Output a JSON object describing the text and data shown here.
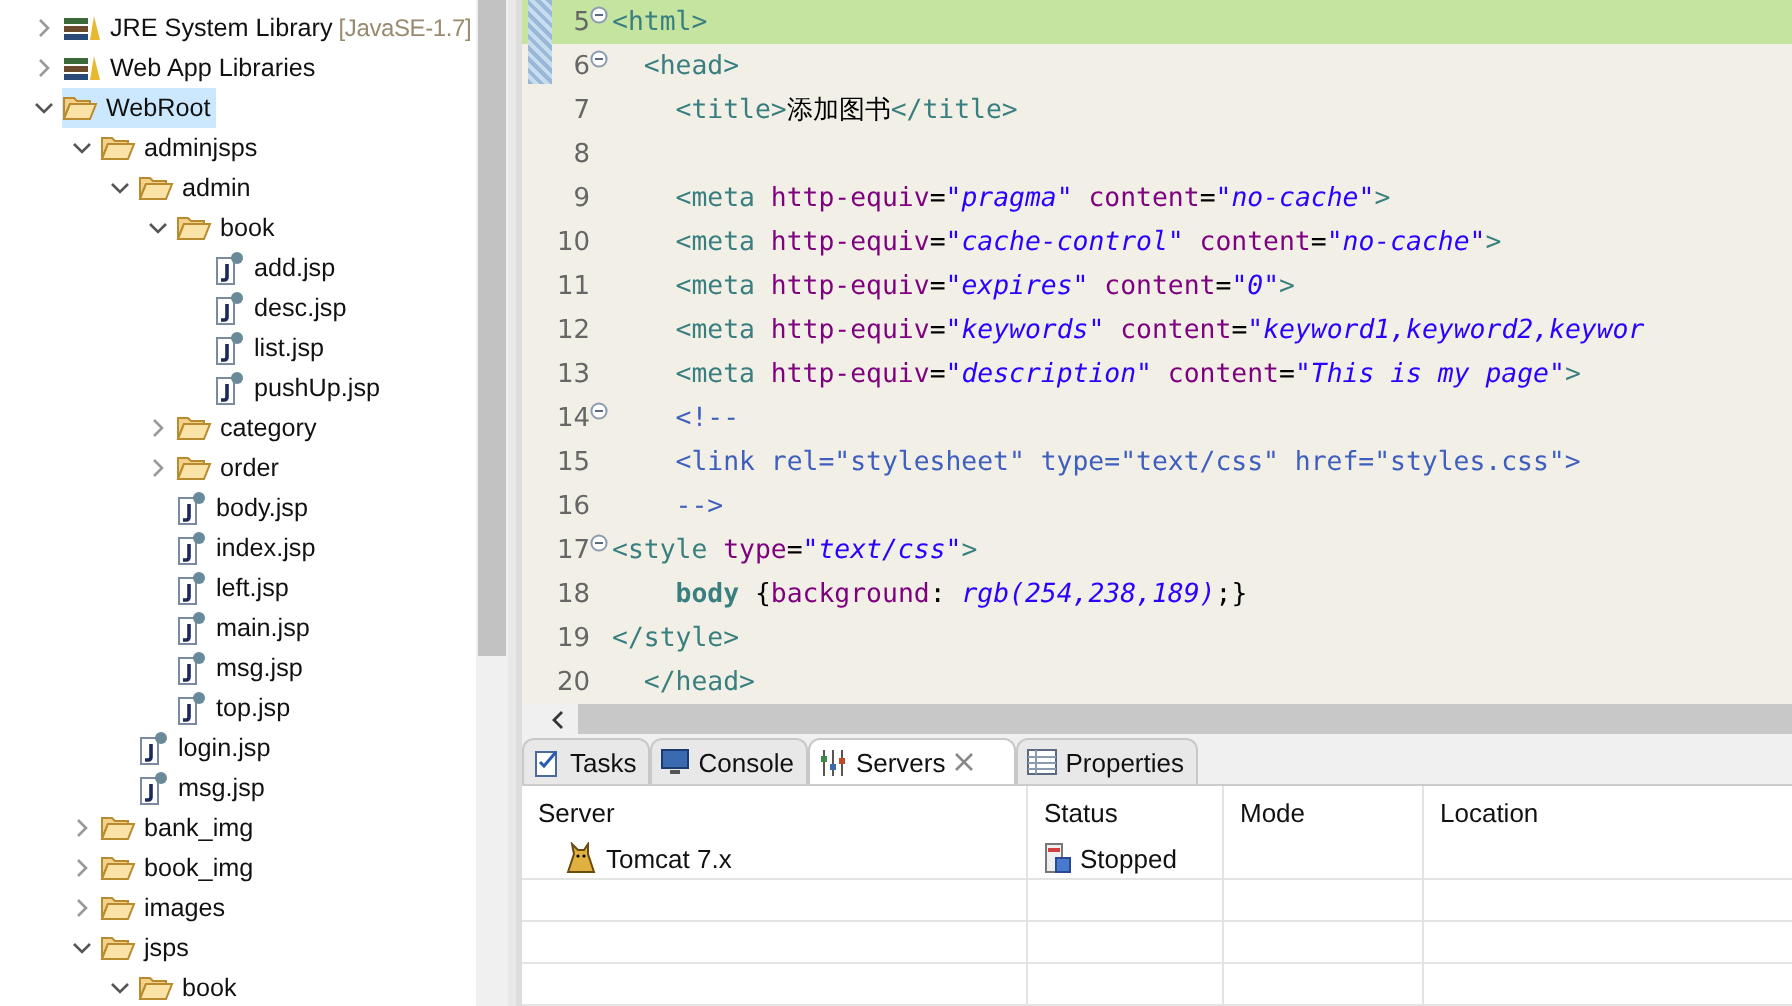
{
  "explorer": {
    "items": [
      {
        "label": "JRE System Library",
        "decoration": "[JavaSE-1.7]",
        "kind": "library",
        "expanded": false,
        "selected": false
      },
      {
        "label": "Web App Libraries",
        "kind": "library",
        "expanded": false,
        "selected": false
      },
      {
        "label": "WebRoot",
        "kind": "folder",
        "expanded": true,
        "selected": true,
        "children": [
          {
            "label": "adminjsps",
            "kind": "folder",
            "expanded": true,
            "selected": false,
            "children": [
              {
                "label": "admin",
                "kind": "folder",
                "expanded": true,
                "selected": false,
                "children": [
                  {
                    "label": "book",
                    "kind": "folder",
                    "expanded": true,
                    "selected": false,
                    "children": [
                      {
                        "label": "add.jsp",
                        "kind": "file",
                        "selected": false
                      },
                      {
                        "label": "desc.jsp",
                        "kind": "file",
                        "selected": false
                      },
                      {
                        "label": "list.jsp",
                        "kind": "file",
                        "selected": false
                      },
                      {
                        "label": "pushUp.jsp",
                        "kind": "file",
                        "selected": false
                      }
                    ]
                  },
                  {
                    "label": "category",
                    "kind": "folder",
                    "expanded": false,
                    "selected": false
                  },
                  {
                    "label": "order",
                    "kind": "folder",
                    "expanded": false,
                    "selected": false
                  },
                  {
                    "label": "body.jsp",
                    "kind": "file",
                    "selected": false
                  },
                  {
                    "label": "index.jsp",
                    "kind": "file",
                    "selected": false
                  },
                  {
                    "label": "left.jsp",
                    "kind": "file",
                    "selected": false
                  },
                  {
                    "label": "main.jsp",
                    "kind": "file",
                    "selected": false
                  },
                  {
                    "label": "msg.jsp",
                    "kind": "file",
                    "selected": false
                  },
                  {
                    "label": "top.jsp",
                    "kind": "file",
                    "selected": false
                  }
                ]
              },
              {
                "label": "login.jsp",
                "kind": "file",
                "selected": false
              },
              {
                "label": "msg.jsp",
                "kind": "file",
                "selected": false
              }
            ]
          },
          {
            "label": "bank_img",
            "kind": "folder",
            "expanded": false,
            "selected": false
          },
          {
            "label": "book_img",
            "kind": "folder",
            "expanded": false,
            "selected": false
          },
          {
            "label": "images",
            "kind": "folder",
            "expanded": false,
            "selected": false
          },
          {
            "label": "jsps",
            "kind": "folder",
            "expanded": true,
            "selected": false,
            "children": [
              {
                "label": "book",
                "kind": "folder",
                "expanded": true,
                "selected": false
              }
            ]
          }
        ]
      }
    ]
  },
  "editor": {
    "lines": [
      {
        "number": "5",
        "fold": true,
        "current": true,
        "tokens": [
          {
            "kind": "tag",
            "text": "<html>"
          }
        ]
      },
      {
        "number": "6",
        "fold": true,
        "current": false,
        "tokens": [
          {
            "kind": "tag",
            "text": "  <head>"
          }
        ]
      },
      {
        "number": "7",
        "fold": false,
        "current": false,
        "tokens": [
          {
            "kind": "tag",
            "text": "    <title>"
          },
          {
            "kind": "text",
            "text": "添加图书"
          },
          {
            "kind": "tag",
            "text": "</title>"
          }
        ]
      },
      {
        "number": "8",
        "fold": false,
        "current": false
      },
      {
        "number": "9",
        "fold": false,
        "current": false,
        "tokens": [
          {
            "kind": "tag",
            "text": "    <meta"
          },
          {
            "kind": "attr",
            "text": " http-equiv"
          },
          {
            "kind": "plain",
            "text": "="
          },
          {
            "kind": "value",
            "text": "\"pragma\""
          },
          {
            "kind": "attr",
            "text": " content"
          },
          {
            "kind": "plain",
            "text": "="
          },
          {
            "kind": "value",
            "text": "\"no-cache\""
          },
          {
            "kind": "tag",
            "text": ">"
          }
        ]
      },
      {
        "number": "10",
        "fold": false,
        "current": false,
        "tokens": [
          {
            "kind": "tag",
            "text": "    <meta"
          },
          {
            "kind": "attr",
            "text": " http-equiv"
          },
          {
            "kind": "plain",
            "text": "="
          },
          {
            "kind": "value",
            "text": "\"cache-control\""
          },
          {
            "kind": "attr",
            "text": " content"
          },
          {
            "kind": "plain",
            "text": "="
          },
          {
            "kind": "value",
            "text": "\"no-cache\""
          },
          {
            "kind": "tag",
            "text": ">"
          }
        ]
      },
      {
        "number": "11",
        "fold": false,
        "current": false,
        "tokens": [
          {
            "kind": "tag",
            "text": "    <meta"
          },
          {
            "kind": "attr",
            "text": " http-equiv"
          },
          {
            "kind": "plain",
            "text": "="
          },
          {
            "kind": "value",
            "text": "\"expires\""
          },
          {
            "kind": "attr",
            "text": " content"
          },
          {
            "kind": "plain",
            "text": "="
          },
          {
            "kind": "value",
            "text": "\"0\""
          },
          {
            "kind": "tag",
            "text": ">"
          }
        ]
      },
      {
        "number": "12",
        "fold": false,
        "current": false,
        "tokens": [
          {
            "kind": "tag",
            "text": "    <meta"
          },
          {
            "kind": "attr",
            "text": " http-equiv"
          },
          {
            "kind": "plain",
            "text": "="
          },
          {
            "kind": "value",
            "text": "\"keywords\""
          },
          {
            "kind": "attr",
            "text": " content"
          },
          {
            "kind": "plain",
            "text": "="
          },
          {
            "kind": "value",
            "text": "\"keyword1,keyword2,keywor"
          }
        ]
      },
      {
        "number": "13",
        "fold": false,
        "current": false,
        "tokens": [
          {
            "kind": "tag",
            "text": "    <meta"
          },
          {
            "kind": "attr",
            "text": " http-equiv"
          },
          {
            "kind": "plain",
            "text": "="
          },
          {
            "kind": "value",
            "text": "\"description\""
          },
          {
            "kind": "attr",
            "text": " content"
          },
          {
            "kind": "plain",
            "text": "="
          },
          {
            "kind": "value",
            "text": "\"This is my page\""
          },
          {
            "kind": "tag",
            "text": ">"
          }
        ]
      },
      {
        "number": "14",
        "fold": true,
        "current": false,
        "tokens": [
          {
            "kind": "comment",
            "text": "    <!--"
          }
        ]
      },
      {
        "number": "15",
        "fold": false,
        "current": false,
        "tokens": [
          {
            "kind": "comment",
            "text": "    <link rel=\"stylesheet\" type=\"text/css\" href=\"styles.css\">"
          }
        ]
      },
      {
        "number": "16",
        "fold": false,
        "current": false,
        "tokens": [
          {
            "kind": "comment",
            "text": "    -->"
          }
        ]
      },
      {
        "number": "17",
        "fold": true,
        "current": false,
        "tokens": [
          {
            "kind": "tag",
            "text": "<style"
          },
          {
            "kind": "attr",
            "text": " type"
          },
          {
            "kind": "plain",
            "text": "="
          },
          {
            "kind": "value",
            "text": "\"text/css\""
          },
          {
            "kind": "tag",
            "text": ">"
          }
        ]
      },
      {
        "number": "18",
        "fold": false,
        "current": false,
        "tokens": [
          {
            "kind": "keyword",
            "text": "    body"
          },
          {
            "kind": "plain",
            "text": " {"
          },
          {
            "kind": "attr",
            "text": "background"
          },
          {
            "kind": "plain",
            "text": ": "
          },
          {
            "kind": "value",
            "text": "rgb(254,238,189)"
          },
          {
            "kind": "plain",
            "text": ";}"
          }
        ]
      },
      {
        "number": "19",
        "fold": false,
        "current": false,
        "tokens": [
          {
            "kind": "tag",
            "text": "</style>"
          }
        ]
      },
      {
        "number": "20",
        "fold": false,
        "current": false,
        "tokens": [
          {
            "kind": "tag",
            "text": "  </head>"
          }
        ]
      }
    ]
  },
  "bottom_panel": {
    "tabs": [
      {
        "label": "Tasks",
        "kind": "tasks",
        "selected": false,
        "closable": false
      },
      {
        "label": "Console",
        "kind": "console",
        "selected": false,
        "closable": false
      },
      {
        "label": "Servers",
        "kind": "servers",
        "selected": true,
        "closable": true
      },
      {
        "label": "Properties",
        "kind": "properties",
        "selected": false,
        "closable": false
      }
    ],
    "table": {
      "columns": [
        "Server",
        "Status",
        "Mode",
        "Location"
      ],
      "rows": [
        {
          "server": "Tomcat  7.x",
          "status": "Stopped"
        }
      ]
    }
  }
}
